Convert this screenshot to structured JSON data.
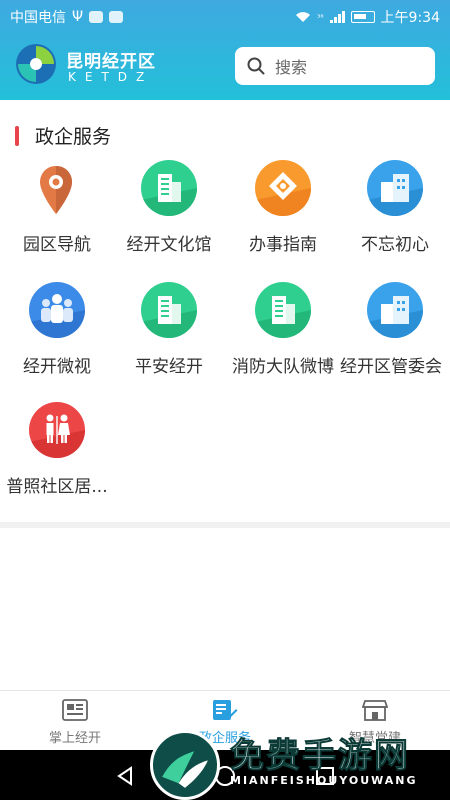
{
  "status_bar": {
    "carrier": "中国电信",
    "usb_symbol": "Ψ",
    "network_type": "³⁶",
    "time": "上午9:34"
  },
  "header": {
    "logo_cn": "昆明经开区",
    "logo_en": "KETDZ",
    "search_placeholder": "搜索"
  },
  "section": {
    "title": "政企服务",
    "accent_color": "#e9434d"
  },
  "services": [
    {
      "label": "园区导航",
      "icon": "location-pin-icon",
      "color": "#f17f3e"
    },
    {
      "label": "经开文化馆",
      "icon": "building-icon",
      "color": "#2fcf8f"
    },
    {
      "label": "办事指南",
      "icon": "diamond-icon",
      "color": "#f99a2e"
    },
    {
      "label": "不忘初心",
      "icon": "building-icon",
      "color": "#3aa2ea"
    },
    {
      "label": "经开微视",
      "icon": "people-icon",
      "color": "#3d8be8"
    },
    {
      "label": "平安经开",
      "icon": "building-icon",
      "color": "#2fcf8f"
    },
    {
      "label": "消防大队微博",
      "icon": "building-icon",
      "color": "#2fcf8f"
    },
    {
      "label": "经开区管委会",
      "icon": "building-icon",
      "color": "#3aa2ea"
    },
    {
      "label": "普照社区居...",
      "icon": "restroom-icon",
      "color": "#ec4646"
    }
  ],
  "tabs": [
    {
      "label": "掌上经开",
      "icon": "newspaper-icon",
      "active": false
    },
    {
      "label": "政企服务",
      "icon": "service-icon",
      "active": true
    },
    {
      "label": "智慧党建",
      "icon": "store-icon",
      "active": false
    }
  ],
  "watermark": {
    "title": "免费手游网",
    "subtitle": "MIANFEISHOUYOUWANG"
  }
}
